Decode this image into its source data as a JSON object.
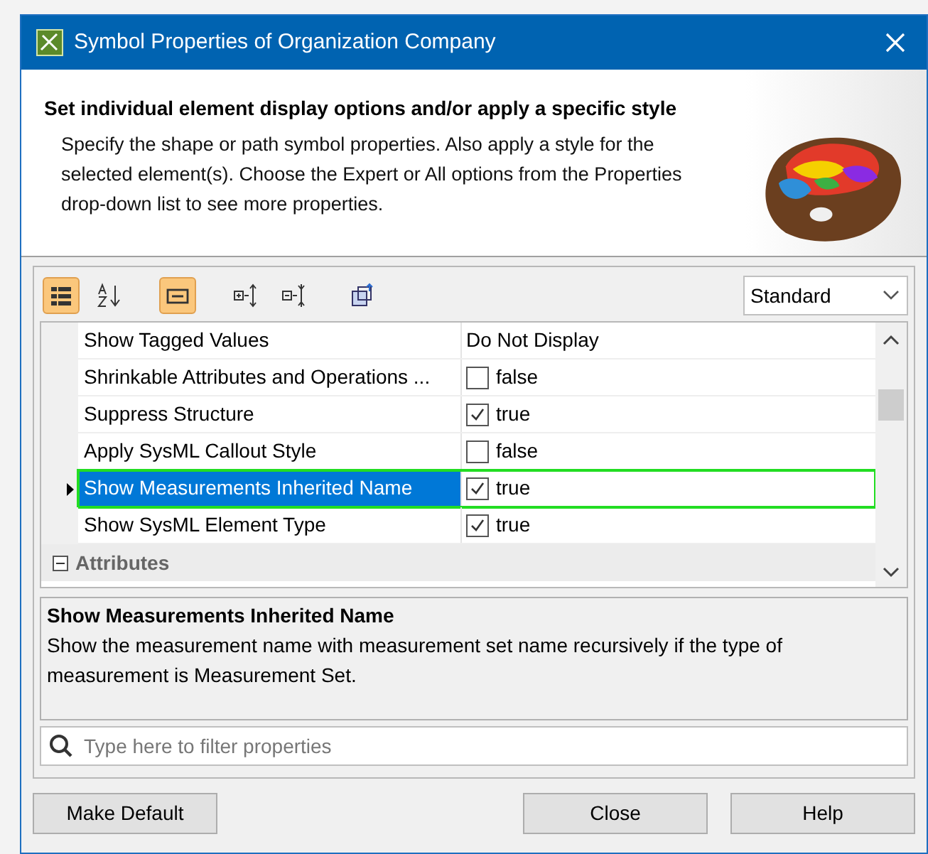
{
  "window": {
    "title": "Symbol Properties of Organization Company"
  },
  "header": {
    "heading": "Set individual element display options and/or apply a specific style",
    "text": "Specify the shape or path symbol properties. Also apply a style for the selected element(s). Choose the Expert or All options from the Properties drop-down list to see more properties."
  },
  "toolbar": [
    {
      "selected": true
    },
    {
      "selected": false
    },
    {
      "selected": true
    },
    {
      "selected": false
    },
    {
      "selected": false
    },
    {
      "selected": false
    }
  ],
  "mode_dropdown": {
    "value": "Standard"
  },
  "properties": [
    {
      "kind": "text",
      "name": "Show Tagged Values",
      "value": "Do Not Display",
      "selected": false
    },
    {
      "kind": "checkbox",
      "name": "Shrinkable Attributes and Operations ...",
      "value": "false",
      "checked": false,
      "selected": false
    },
    {
      "kind": "checkbox",
      "name": "Suppress Structure",
      "value": "true",
      "checked": true,
      "selected": false
    },
    {
      "kind": "checkbox",
      "name": "Apply SysML Callout Style",
      "value": "false",
      "checked": false,
      "selected": false
    },
    {
      "kind": "checkbox",
      "name": "Show Measurements Inherited Name",
      "value": "true",
      "checked": true,
      "selected": true
    },
    {
      "kind": "checkbox",
      "name": "Show SysML Element Type",
      "value": "true",
      "checked": true,
      "selected": false
    },
    {
      "kind": "group",
      "name": "Attributes",
      "expanded": true
    }
  ],
  "description": {
    "title": "Show Measurements Inherited Name",
    "text": "Show the measurement name with measurement set name recursively if the type of measurement is Measurement Set."
  },
  "filter": {
    "placeholder": "Type here to filter properties"
  },
  "buttons": {
    "left": [
      "Make Default"
    ],
    "right": [
      "Close",
      "Help"
    ]
  }
}
